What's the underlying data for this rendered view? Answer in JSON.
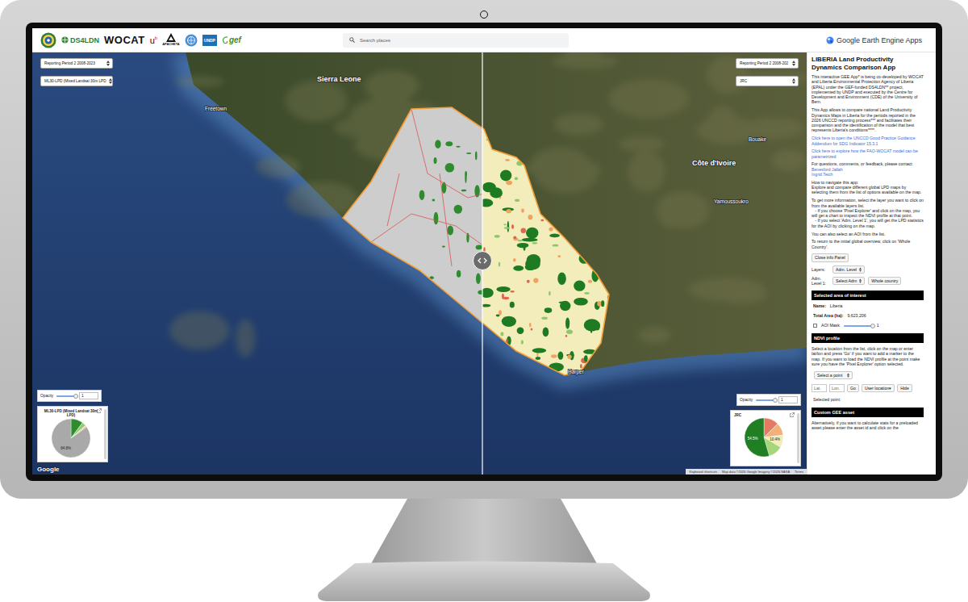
{
  "header": {
    "logos": [
      {
        "kind": "seal"
      },
      {
        "kind": "ds4ldn",
        "text": "DS4LDN"
      },
      {
        "kind": "wocat",
        "text": "WOCAT"
      },
      {
        "kind": "bern",
        "text": "u",
        "sup": "b"
      },
      {
        "kind": "apacheta",
        "text": "APACHETA"
      },
      {
        "kind": "un"
      },
      {
        "kind": "undp",
        "text": "UNDP"
      },
      {
        "kind": "gef",
        "text": "gef"
      }
    ],
    "search": {
      "placeholder": "Search places"
    },
    "app_title": "Google Earth Engine Apps"
  },
  "map": {
    "panes": [
      {
        "side": "left",
        "period": "Reporting Period 2 2008-2023",
        "layer": "ML30-LPD (Mixed Landsat 30m LPD",
        "opacity": {
          "label": "Opacity",
          "value": "1",
          "level": 1
        },
        "chart": {
          "title": "ML30-LPD (Mixed Landsat 30m LPD)",
          "slices": [
            {
              "value": 10.2,
              "color": "#2e8b2e"
            },
            {
              "value": 3.5,
              "color": "#8fcf6e"
            },
            {
              "value": 0.8,
              "color": "#f1e8a8"
            },
            {
              "value": 0.7,
              "color": "#e0674f"
            },
            {
              "value": 84.8,
              "color": "#a9a9a9",
              "label": "84.8%"
            }
          ]
        }
      },
      {
        "side": "right",
        "period": "Reporting Period 2 2008-202",
        "layer": "JRC",
        "opacity": {
          "label": "Opacity",
          "value": "1",
          "level": 1
        },
        "chart": {
          "title": "JRC",
          "slices": [
            {
              "value": 12.6,
              "color": "#e57a63"
            },
            {
              "value": 10.5,
              "color": "#f2b179"
            },
            {
              "value": 10.4,
              "color": "#f3ecb8",
              "label": "10.4%"
            },
            {
              "value": 12.0,
              "color": "#a5d67a"
            },
            {
              "value": 54.5,
              "color": "#1f7f22",
              "label": "54.5%"
            }
          ]
        }
      }
    ],
    "place_labels": [
      {
        "text": "Sierra Leone",
        "kind": "country"
      },
      {
        "text": "Freetown",
        "kind": "city"
      },
      {
        "text": "Côte d'Ivoire",
        "kind": "country"
      },
      {
        "text": "Bouake",
        "kind": "city"
      },
      {
        "text": "Yamoussoukro",
        "kind": "city"
      },
      {
        "text": "Harper",
        "kind": "city"
      }
    ],
    "attribution": {
      "logo": "Google",
      "shortcuts": "Keyboard shortcuts",
      "data": "Map data ©2026 Google Imagery ©2026 NASA",
      "terms": "Terms"
    }
  },
  "info_panel": {
    "title": "LIBERIA Land Productivity Dynamics Comparison App",
    "blocks": [
      {
        "kind": "text",
        "lines": [
          "This interactive GEE App* is being co-developed by WOCAT and Liberia Environmental Protection Agency of Liberia (EPAL) under the GEF-funded DS4LDN** project, implemented by UNDP and executed by the Centre for Development and Environment (CDE) of the University of Bern."
        ]
      },
      {
        "kind": "text",
        "lines": [
          "This App allows to compare national Land Productivity Dynamics Maps in Liberia for the periods reported in the 2026 UNCCD reporting process*** and facilitates their comparison and the identification of the model that best represents Liberia's conditions****."
        ]
      },
      {
        "kind": "link",
        "lines": [
          "Click here to open the UNCCD Good Practice Guidance Addendum for SDG Indicator 15.3.1"
        ]
      },
      {
        "kind": "link",
        "lines": [
          "Click here to explore how the FAO-WOCAT model can be parametrized"
        ]
      },
      {
        "kind": "contact",
        "lines": [
          "For questions, comments, or feedback, please contact:"
        ],
        "links": [
          "Benesford Jallah",
          "Ingrid Teich"
        ]
      },
      {
        "kind": "text",
        "lines": [
          "How to navigate this app:",
          "Explore and compare different global LPD maps by selecting them from the list of options available on the map."
        ]
      },
      {
        "kind": "text",
        "lines": [
          "To get more information, select the layer you want to click on from the available layers list.",
          "   - If you choose 'Pixel Explorer' and click on the map, you will get a chart to inspect the NDVI profile at that point.",
          "   - If you select 'Adm. Level 1', you will get the LPD statistics for the AOI by clicking on the map."
        ]
      },
      {
        "kind": "text",
        "lines": [
          "You can also select an AOI from the list."
        ]
      },
      {
        "kind": "text",
        "lines": [
          "To return to the initial global overview, click on 'Whole Country'."
        ]
      }
    ],
    "close_button": "Close info Panel",
    "layers": {
      "label": "Layers:",
      "value": "Adm. Level"
    },
    "adm1": {
      "label": "Adm. Level 1:",
      "value": "Select Adm",
      "button": "Whole country"
    },
    "aoi": {
      "title": "Selected area of interest",
      "fields": [
        {
          "label": "Name:",
          "value": "Liberia"
        },
        {
          "label": "Total Area (ha):",
          "value": "9,623,206"
        }
      ],
      "mask": {
        "label": "AOI Mask",
        "checked": false,
        "value": "1",
        "level": 1
      }
    },
    "ndvi": {
      "title": "NDVI profile",
      "text": "Select a location from the list, click on the map or enter lat/lon and press 'Go' if you want to add a marker to the map. If you want to load the NDVI profile at the point make sure you have the 'Pixel Explorer' option selected.",
      "point_select": "Select a point",
      "lat_placeholder": "Lat.",
      "lon_placeholder": "Lon.",
      "go": "Go",
      "location": "User location▾",
      "hide": "Hide",
      "selected_point": "Selected point:"
    },
    "custom": {
      "title": "Custom GEE asset",
      "text": "Alternatively, if you want to calculate stats for a preloaded asset please enter the asset id and click on the"
    }
  }
}
